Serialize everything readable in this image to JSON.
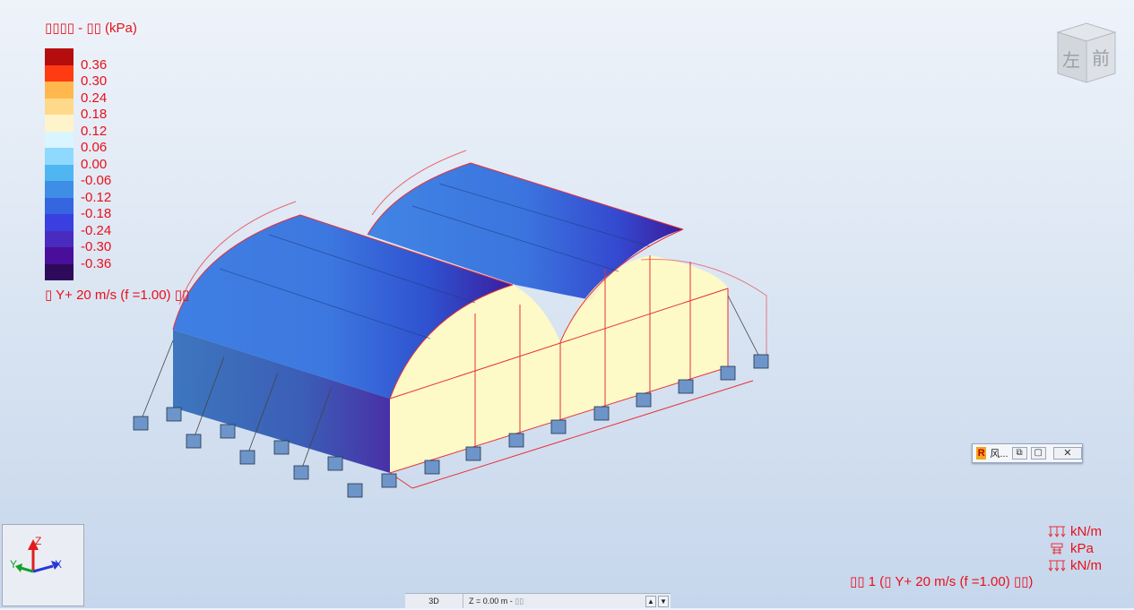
{
  "legend": {
    "title": "▯▯▯▯ - ▯▯ (kPa)",
    "swatch_colors": [
      "#b50d0d",
      "#ff3b12",
      "#ffb84d",
      "#ffd98a",
      "#fff3cc",
      "#d9f5ff",
      "#8fd9ff",
      "#4fb6f2",
      "#3f8ee6",
      "#3565e0",
      "#3a3fe0",
      "#4a2bc0",
      "#4a0f9a",
      "#2e0a5a"
    ],
    "labels": [
      "0.36",
      "0.30",
      "0.24",
      "0.18",
      "0.12",
      "0.06",
      "0.00",
      "-0.06",
      "-0.12",
      "-0.18",
      "-0.24",
      "-0.30",
      "-0.36"
    ]
  },
  "load_case_caption": "▯ Y+ 20 m/s (f =1.00) ▯▯",
  "viewcube": {
    "left_face": "左",
    "front_face": "前"
  },
  "mini_window": {
    "icon": "R",
    "title": "风...",
    "restore_icon": "⧉",
    "max_icon": "▢",
    "close_icon": "✕"
  },
  "axes": {
    "z": "Z",
    "y": "Y",
    "x": "X"
  },
  "units": [
    {
      "icon": "distributed-load-icon",
      "label": "kN/m"
    },
    {
      "icon": "surface-load-icon",
      "label": "kPa"
    },
    {
      "icon": "distributed-load-icon",
      "label": "kN/m"
    }
  ],
  "bottom_caption": "▯▯ 1 (▯ Y+ 20 m/s (f =1.00) ▯▯)",
  "status_bar": {
    "view": "3D",
    "z_level": "Z = 0.00 m - ",
    "z_suffix": "▯▯"
  },
  "colors": {
    "roof_blue": "#3d7fe0",
    "roof_dark": "#3a1fb0",
    "gable_yellow": "#fffbc4",
    "frame_red": "#e8303a",
    "support_blue": "#6e95c9"
  }
}
